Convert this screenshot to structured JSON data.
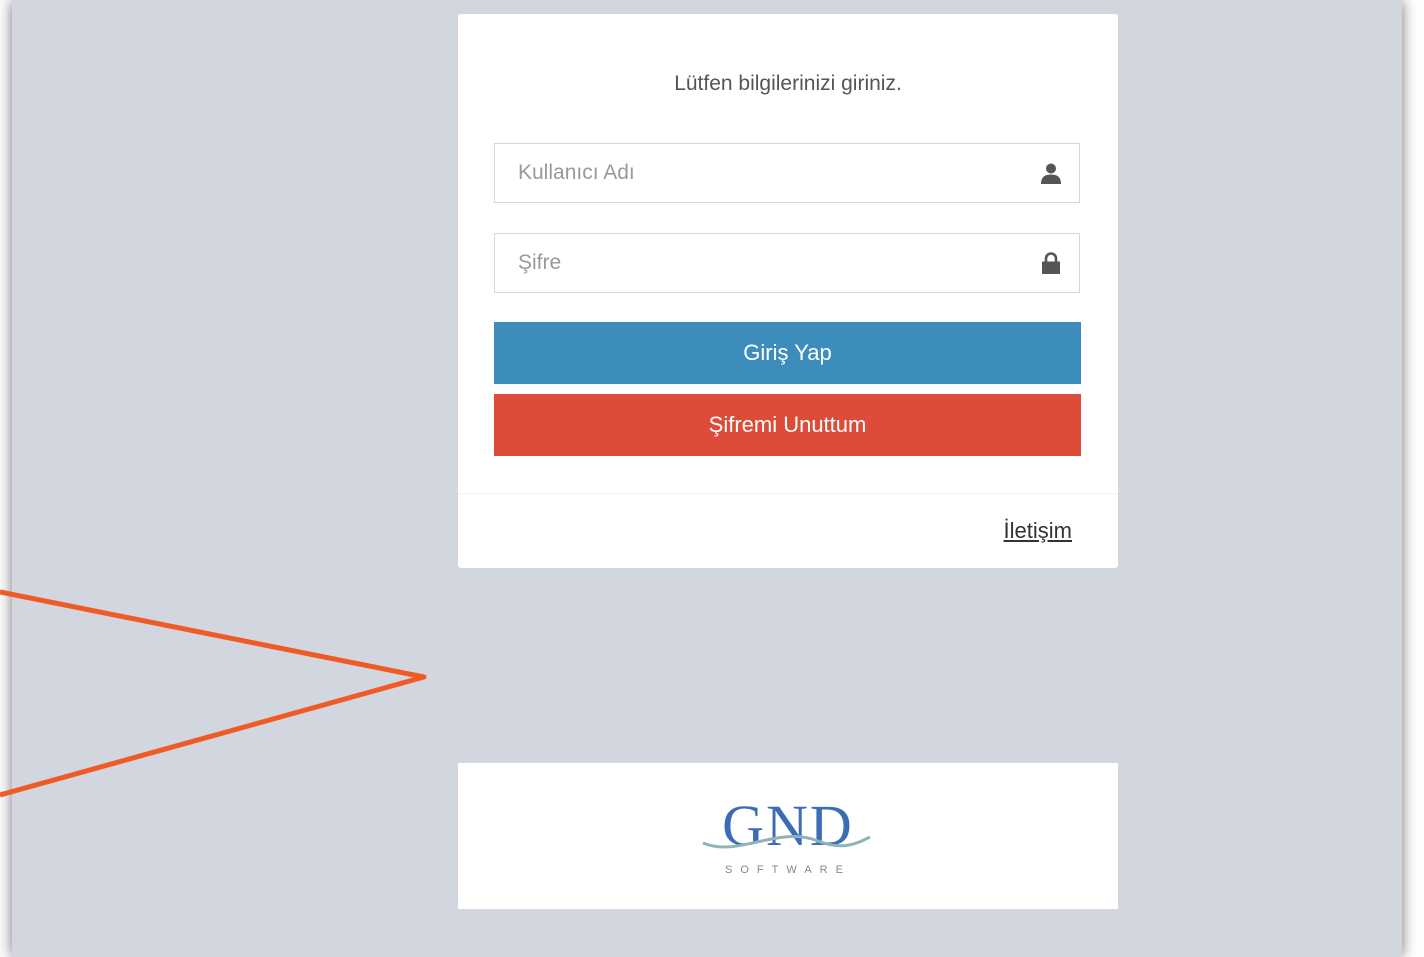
{
  "login": {
    "message": "Lütfen bilgilerinizi giriniz.",
    "username_placeholder": "Kullanıcı Adı",
    "username_value": "",
    "password_placeholder": "Şifre",
    "password_value": "",
    "login_button": "Giriş Yap",
    "forgot_button": "Şifremi Unuttum",
    "contact_link": "İletişim"
  },
  "logo": {
    "name": "GND",
    "subtitle": "SOFTWARE"
  },
  "icons": {
    "username": "user-icon",
    "password": "lock-icon"
  },
  "colors": {
    "background": "#d2d6de",
    "primary": "#3c8dbc",
    "danger": "#dd4b39",
    "annotation_arrow": "#f05a24",
    "logo_blue": "#3a6db5"
  }
}
